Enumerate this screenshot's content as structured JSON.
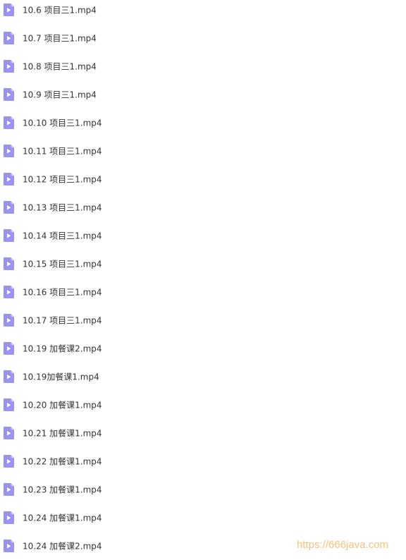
{
  "colors": {
    "icon_fill": "#9a91f5",
    "icon_fold": "#c7c1fb",
    "icon_play": "#ffffff",
    "filename_text": "#333333",
    "watermark_text": "#f5c37a"
  },
  "file_icon": "video-file-icon",
  "files": [
    {
      "name": "10.6 项目三1.mp4"
    },
    {
      "name": "10.7 项目三1.mp4"
    },
    {
      "name": "10.8 项目三1.mp4"
    },
    {
      "name": "10.9 项目三1.mp4"
    },
    {
      "name": "10.10 项目三1.mp4"
    },
    {
      "name": "10.11 项目三1.mp4"
    },
    {
      "name": "10.12 项目三1.mp4"
    },
    {
      "name": "10.13 项目三1.mp4"
    },
    {
      "name": "10.14 项目三1.mp4"
    },
    {
      "name": "10.15 项目三1.mp4"
    },
    {
      "name": "10.16 项目三1.mp4"
    },
    {
      "name": "10.17 项目三1.mp4"
    },
    {
      "name": "10.19 加餐课2.mp4"
    },
    {
      "name": "10.19加餐课1.mp4"
    },
    {
      "name": "10.20 加餐课1.mp4"
    },
    {
      "name": "10.21 加餐课1.mp4"
    },
    {
      "name": "10.22 加餐课1.mp4"
    },
    {
      "name": "10.23 加餐课1.mp4"
    },
    {
      "name": "10.24 加餐课1.mp4"
    },
    {
      "name": "10.24 加餐课2.mp4"
    }
  ],
  "watermark": "https://666java.com"
}
